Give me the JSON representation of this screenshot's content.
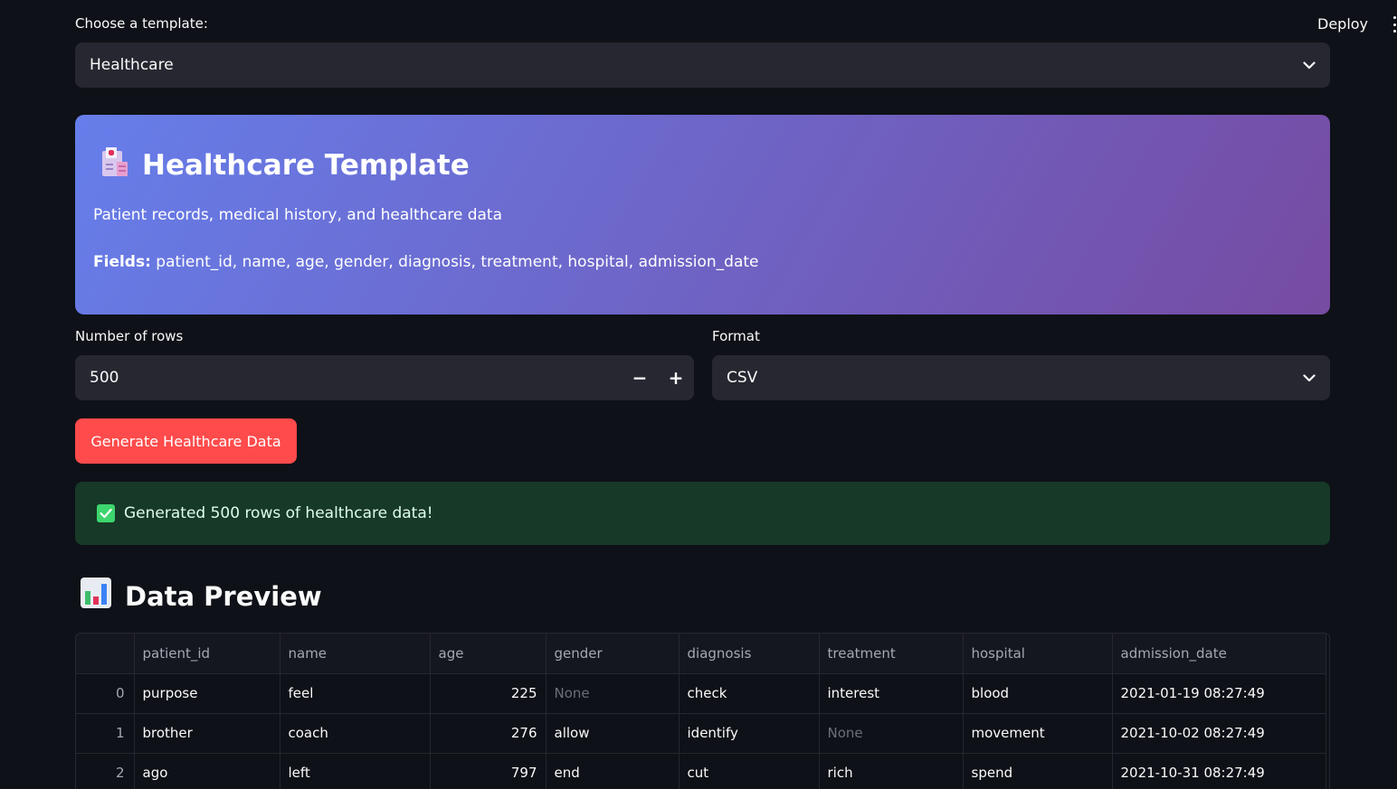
{
  "header": {
    "deploy_label": "Deploy"
  },
  "template_select": {
    "label": "Choose a template:",
    "value": "Healthcare"
  },
  "hero": {
    "title": "Healthcare Template",
    "description": "Patient records, medical history, and healthcare data",
    "fields_label": "Fields:",
    "fields_value": "patient_id, name, age, gender, diagnosis, treatment, hospital, admission_date",
    "icon": "hospital-icon"
  },
  "rows_input": {
    "label": "Number of rows",
    "value": "500",
    "minus": "−",
    "plus": "+"
  },
  "format_select": {
    "label": "Format",
    "value": "CSV"
  },
  "generate_button": {
    "label": "Generate Healthcare Data"
  },
  "success": {
    "message": "Generated 500 rows of healthcare data!"
  },
  "preview": {
    "title": "Data Preview",
    "icon": "bar-chart-icon"
  },
  "table": {
    "columns": [
      "",
      "patient_id",
      "name",
      "age",
      "gender",
      "diagnosis",
      "treatment",
      "hospital",
      "admission_date"
    ],
    "rows": [
      [
        "0",
        "purpose",
        "feel",
        "225",
        "None",
        "check",
        "interest",
        "blood",
        "2021-01-19 08:27:49"
      ],
      [
        "1",
        "brother",
        "coach",
        "276",
        "allow",
        "identify",
        "None",
        "movement",
        "2021-10-02 08:27:49"
      ],
      [
        "2",
        "ago",
        "left",
        "797",
        "end",
        "cut",
        "rich",
        "spend",
        "2021-10-31 08:27:49"
      ]
    ]
  },
  "colors": {
    "background": "#0e1117",
    "primary_button": "#ff4b4b",
    "success_bg": "#173928",
    "hero_gradient_start": "#667eea",
    "hero_gradient_end": "#764ba2"
  }
}
